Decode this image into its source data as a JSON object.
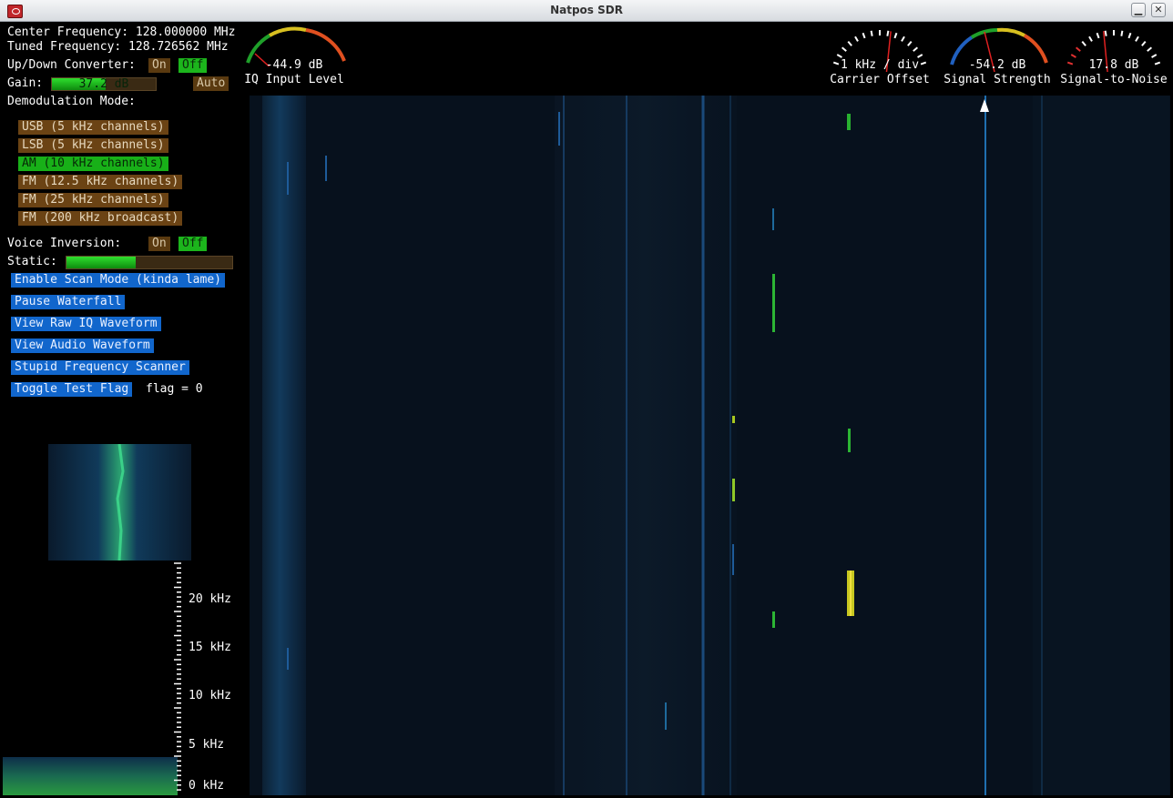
{
  "window": {
    "title": "Natpos SDR",
    "minimize_glyph": "▁",
    "close_glyph": "✕"
  },
  "freq": {
    "center": "Center Frequency: 128.000000 MHz",
    "tuned": "Tuned Frequency: 128.726562 MHz"
  },
  "converter": {
    "label": "Up/Down Converter:",
    "on": "On",
    "off": "Off",
    "selected": "off"
  },
  "gain": {
    "label": "Gain:",
    "value": "37.2 dB",
    "fraction": 0.52,
    "auto": "Auto"
  },
  "demod": {
    "label": "Demodulation Mode:",
    "modes": [
      {
        "label": "USB (5 kHz channels)",
        "selected": false
      },
      {
        "label": "LSB (5 kHz channels)",
        "selected": false
      },
      {
        "label": "AM (10 kHz channels)",
        "selected": true
      },
      {
        "label": "FM (12.5 kHz channels)",
        "selected": false
      },
      {
        "label": "FM (25 kHz channels)",
        "selected": false
      },
      {
        "label": "FM (200 kHz broadcast)",
        "selected": false
      }
    ]
  },
  "voice": {
    "label": "Voice Inversion:",
    "on": "On",
    "off": "Off",
    "selected": "off"
  },
  "static": {
    "label": "Static:",
    "fraction": 0.42
  },
  "actions": {
    "scan": "Enable Scan Mode (kinda lame)",
    "pause": "Pause Waterfall",
    "raw_iq": "View Raw IQ Waveform",
    "audio": "View Audio Waveform",
    "scanner": "Stupid Frequency Scanner",
    "test_flag": "Toggle Test Flag",
    "flag_text": "flag = 0"
  },
  "gauges": {
    "iq": {
      "value": "-44.9 dB",
      "label": "IQ Input Level"
    },
    "offset": {
      "value": "1 kHz / div",
      "label": "Carrier Offset"
    },
    "strength": {
      "value": "-54.2 dB",
      "label": "Signal Strength"
    },
    "snr": {
      "value": "17.8 dB",
      "label": "Signal-to-Noise"
    }
  },
  "audio_axis": {
    "ticks": [
      "20 kHz",
      "15 kHz",
      "10 kHz",
      "5 kHz",
      "0 kHz"
    ]
  },
  "colors": {
    "on_green": "#1cb51c",
    "off_brown": "#5a3a10",
    "action_blue": "#1166cc",
    "waterfall_bg": "#06101c"
  }
}
